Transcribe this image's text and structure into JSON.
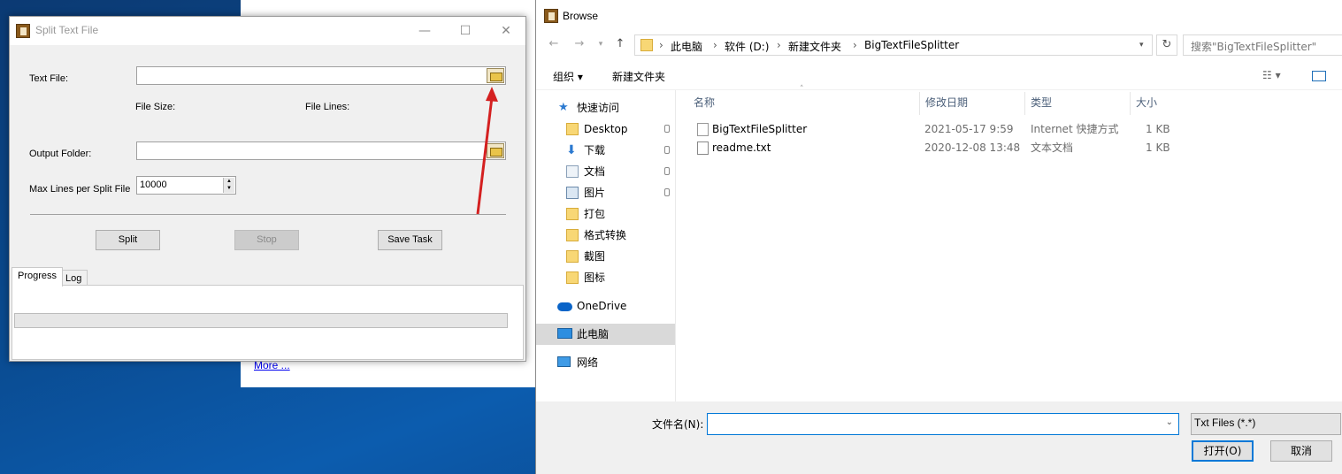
{
  "background_page": {
    "link": "More ..."
  },
  "split_window": {
    "title": "Split Text File",
    "labels": {
      "text_file": "Text File:",
      "file_size": "File Size:",
      "file_lines": "File Lines:",
      "output_folder": "Output Folder:",
      "max_lines": "Max Lines per Split File"
    },
    "max_lines_value": "10000",
    "buttons": {
      "split": "Split",
      "stop": "Stop",
      "save_task": "Save Task"
    },
    "tabs": [
      "Progress",
      "Log"
    ],
    "window_controls": {
      "minimize": "—",
      "maximize": "☐",
      "close": "✕"
    }
  },
  "browse_dialog": {
    "title": "Browse",
    "breadcrumb": [
      "此电脑",
      "软件 (D:)",
      "新建文件夹",
      "BigTextFileSplitter"
    ],
    "search_placeholder": "搜索\"BigTextFileSplitter\"",
    "toolbar": {
      "organize": "组织 ▾",
      "new_folder": "新建文件夹"
    },
    "nav": {
      "quick_access": "快速访问",
      "items": [
        "Desktop",
        "下载",
        "文档",
        "图片",
        "打包",
        "格式转换",
        "截图",
        "图标"
      ],
      "onedrive": "OneDrive",
      "this_pc": "此电脑",
      "network": "网络"
    },
    "columns": {
      "name": "名称",
      "modified": "修改日期",
      "type": "类型",
      "size": "大小"
    },
    "files": [
      {
        "name": "BigTextFileSplitter",
        "modified": "2021-05-17 9:59",
        "type": "Internet 快捷方式",
        "size": "1 KB",
        "icon": "internet-shortcut-icon"
      },
      {
        "name": "readme.txt",
        "modified": "2020-12-08 13:48",
        "type": "文本文档",
        "size": "1 KB",
        "icon": "text-file-icon"
      }
    ],
    "filename_label": "文件名(N):",
    "filter": "Txt Files (*.*)",
    "open_button": "打开(O)",
    "cancel_button": "取消"
  },
  "colors": {
    "accent": "#0078d7",
    "arrow": "#d42020"
  }
}
